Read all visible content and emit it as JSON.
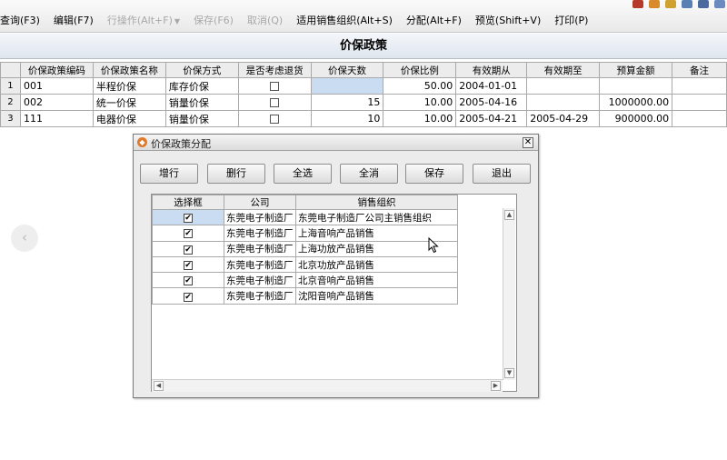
{
  "toolbar": {
    "items": [
      {
        "label": "查询(F3)",
        "disabled": false
      },
      {
        "label": "编辑(F7)",
        "disabled": false
      },
      {
        "label": "行操作(Alt+F)",
        "disabled": true
      },
      {
        "label": "保存(F6)",
        "disabled": true
      },
      {
        "label": "取消(Q)",
        "disabled": true
      },
      {
        "label": "适用销售组织(Alt+S)",
        "disabled": false
      },
      {
        "label": "分配(Alt+F)",
        "disabled": false
      },
      {
        "label": "预览(Shift+V)",
        "disabled": false
      },
      {
        "label": "打印(P)",
        "disabled": false
      }
    ]
  },
  "page": {
    "title": "价保政策"
  },
  "grid": {
    "columns": [
      "价保政策编码",
      "价保政策名称",
      "价保方式",
      "是否考虑退货",
      "价保天数",
      "价保比例",
      "有效期从",
      "有效期至",
      "预算金额",
      "备注"
    ],
    "rows": [
      {
        "n": "1",
        "code": "001",
        "name": "半程价保",
        "method": "库存价保",
        "days": "",
        "ratio": "50.00",
        "from": "2004-01-01",
        "to": "",
        "budget": "",
        "note": ""
      },
      {
        "n": "2",
        "code": "002",
        "name": "统一价保",
        "method": "销量价保",
        "days": "15",
        "ratio": "10.00",
        "from": "2005-04-16",
        "to": "",
        "budget": "1000000.00",
        "note": ""
      },
      {
        "n": "3",
        "code": "111",
        "name": "电器价保",
        "method": "销量价保",
        "days": "10",
        "ratio": "10.00",
        "from": "2005-04-21",
        "to": "2005-04-29",
        "budget": "900000.00",
        "note": ""
      }
    ]
  },
  "dialog": {
    "title": "价保政策分配",
    "buttons": {
      "add": "增行",
      "delete": "删行",
      "select_all": "全选",
      "deselect_all": "全消",
      "save": "保存",
      "exit": "退出"
    },
    "columns": [
      "选择框",
      "公司",
      "销售组织"
    ],
    "rows": [
      {
        "company": "东莞电子制造厂",
        "org": "东莞电子制造厂公司主销售组织"
      },
      {
        "company": "东莞电子制造厂",
        "org": "上海音响产品销售"
      },
      {
        "company": "东莞电子制造厂",
        "org": "上海功放产品销售"
      },
      {
        "company": "东莞电子制造厂",
        "org": "北京功放产品销售"
      },
      {
        "company": "东莞电子制造厂",
        "org": "北京音响产品销售"
      },
      {
        "company": "东莞电子制造厂",
        "org": "沈阳音响产品销售"
      }
    ]
  }
}
